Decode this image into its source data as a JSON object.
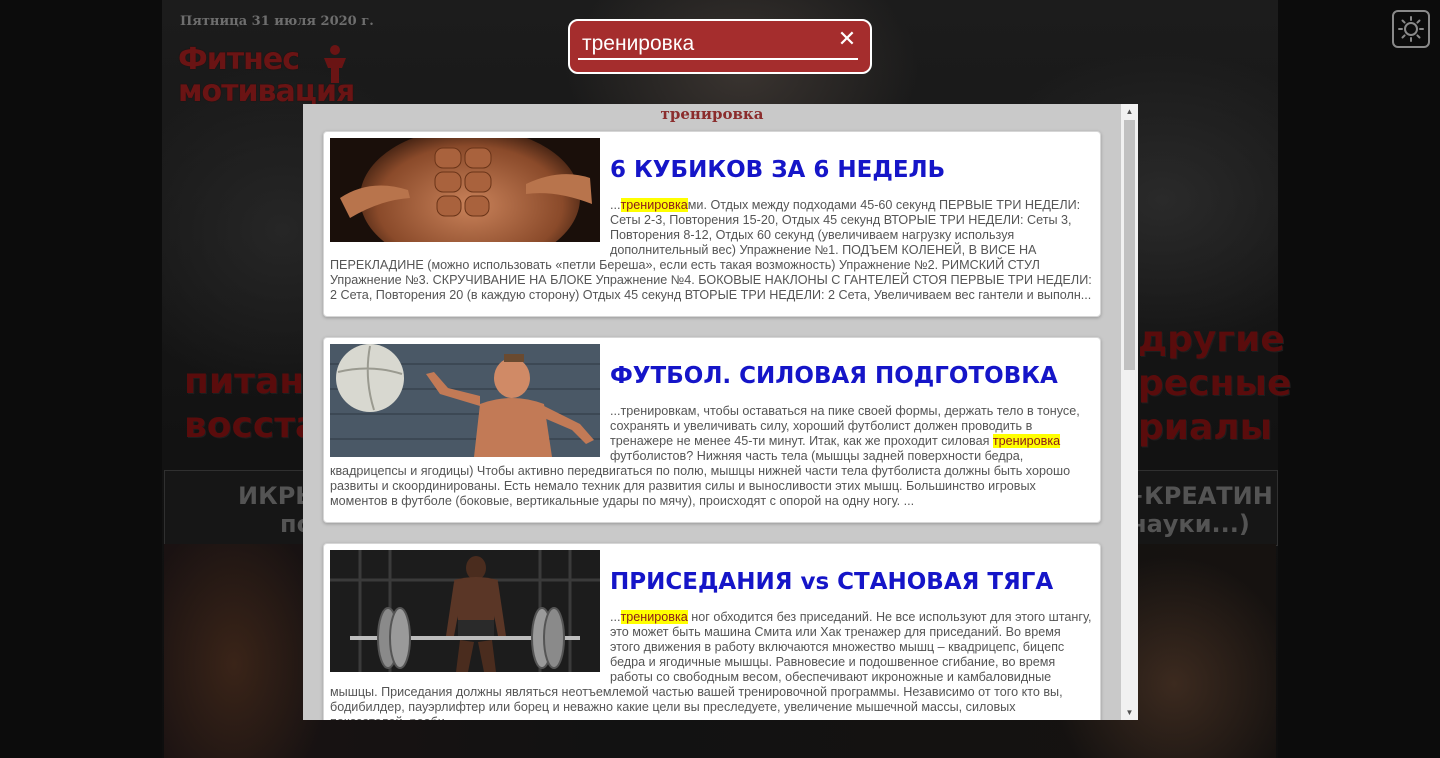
{
  "background": {
    "date": "Пятница 31 июля 2020 г.",
    "logo_line1": "Фитнес",
    "logo_line2": "мотивация",
    "promo_left_line1": "питани",
    "promo_left_line2": "восстан",
    "promo_right_line1": "другие",
    "promo_right_line2": "ресные",
    "promo_right_line3": "риалы",
    "band_left_line1": "ИКРЫ",
    "band_left_line2": "по",
    "band_right_line1": "+КРЕАТИН",
    "band_right_line2": "науки...)"
  },
  "search": {
    "query": "тренировка",
    "clear_icon": "✕"
  },
  "theme_toggle_icon": "sun-icon",
  "results": {
    "heading": "тренировка",
    "highlight_color": "#ffff00",
    "title_color": "#1515c8",
    "items": [
      {
        "title": "6 КУБИКОВ ЗА 6 НЕДЕЛЬ",
        "thumb_icon": "abs-photo",
        "snippet_pre": "...",
        "snippet_hl": "тренировка",
        "snippet_post": "ми. Отдых между подходами 45-60 секунд ПЕРВЫЕ ТРИ НЕДЕЛИ: Сеты 2-3, Повторения 15-20, Отдых 45 секунд ВТОРЫЕ ТРИ НЕДЕЛИ: Сеты 3, Повторения 8-12, Отдых 60 секунд (увеличиваем нагрузку используя дополнительный вес) Упражнение №1. ПОДЪЕМ КОЛЕНЕЙ, В ВИСЕ НА ПЕРЕКЛАДИНЕ (можно использовать «петли Береша», если есть такая возможность) Упражнение №2. РИМСКИЙ СТУЛ Упражнение №3. СКРУЧИВАНИЕ НА БЛОКЕ Упражнение №4. БОКОВЫЕ НАКЛОНЫ С ГАНТЕЛЕЙ СТОЯ ПЕРВЫЕ ТРИ НЕДЕЛИ: 2 Сета, Повторения 20 (в каждую сторону) Отдых 45 секунд ВТОРЫЕ ТРИ НЕДЕЛИ: 2 Сета, Увеличиваем вес гантели и выполн..."
      },
      {
        "title": "ФУТБОЛ. СИЛОВАЯ ПОДГОТОВКА",
        "thumb_icon": "medicine-ball-photo",
        "snippet_pre": "...тренировкам, чтобы оставаться на пике своей формы, держать тело в тонусе, сохранять и увеличивать силу, хороший футболист должен проводить в тренажере не менее 45-ти минут. Итак, как же проходит силовая ",
        "snippet_hl": "тренировка",
        "snippet_post": " футболистов? Нижняя часть тела (мышцы задней поверхности бедра, квадрицепсы и ягодицы) Чтобы активно передвигаться по полю, мышцы нижней части тела футболиста должны быть хорошо развиты и скоординированы. Есть немало техник для развития силы и выносливости этих мышц. Большинство игровых моментов в футболе (боковые, вертикальные удары по мячу), происходят с опорой на одну ногу. ..."
      },
      {
        "title": "ПРИСЕДАНИЯ vs СТАНОВАЯ ТЯГА",
        "thumb_icon": "deadlift-photo",
        "snippet_pre": "...",
        "snippet_hl": "тренировка",
        "snippet_post": " ног обходится без приседаний. Не все используют для этого штангу, это может быть машина Смита или Хак тренажер для приседаний. Во время этого движения в работу включаются множество мышц – квадрицепс, бицепс бедра и ягодичные мышцы. Равновесие и подошвенное сгибание, во время работы со свободным весом, обеспечивают икроножные и камбаловидные мышцы. Приседания должны являться неотъемлемой частью вашей тренировочной программы. Независимо от того кто вы, бодибилдер, пауэрлифтер или борец и неважно какие цели вы преследуете, увеличение мышечной массы, силовых показателей, реаби..."
      }
    ]
  },
  "scrollbar": {
    "up_icon": "▲",
    "down_icon": "▼",
    "position": 0.0
  }
}
